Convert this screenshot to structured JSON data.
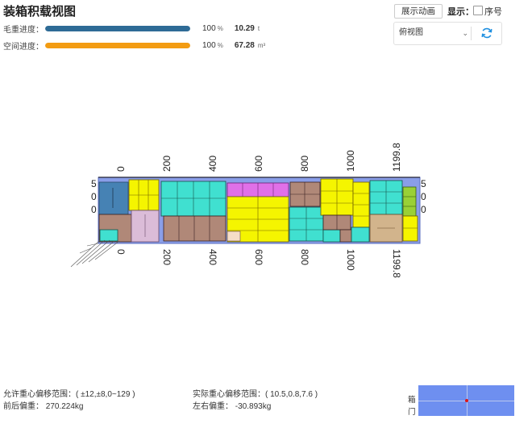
{
  "title": "装箱积载视图",
  "progress": [
    {
      "label": "毛重进度：",
      "percent": "100",
      "percent_unit": "%",
      "value": "10.29",
      "unit": "t",
      "fraction": 1.0,
      "color": "#2e6b96"
    },
    {
      "label": "空间进度：",
      "percent": "100",
      "percent_unit": "%",
      "value": "67.28",
      "unit": "m³",
      "fraction": 1.0,
      "color": "#f39c12"
    }
  ],
  "toolbar": {
    "animate_label": "展示动画",
    "show_label": "显示：",
    "seq_label": "序号",
    "view_value": "俯视图",
    "chevron": "⌄"
  },
  "axis": {
    "ticks": [
      "0",
      "200",
      "400",
      "600",
      "800",
      "1000",
      "1199.8"
    ],
    "left_side": [
      "5",
      "0",
      "0"
    ],
    "right_side": [
      "5",
      "0",
      "0"
    ]
  },
  "footer": {
    "allowed_range": "允许重心偏移范围：( ±12,±8,0~129 )",
    "front_back": "前后偏重： 270.224kg",
    "actual_range": "实际重心偏移范围：( 10.5,0.8,7.6 )",
    "left_right": "左右偏重： -30.893kg",
    "door_top": "箱",
    "door_bottom": "门"
  },
  "colors": {
    "cyan": "#40e0d0",
    "yellow": "#f5f500",
    "brown": "#b08878",
    "pink": "#dbbcd8",
    "magenta": "#e070e8",
    "olive": "#9ad036",
    "tan": "#d2b48c",
    "blue": "#4682b4",
    "container": "#8a9ee8"
  }
}
